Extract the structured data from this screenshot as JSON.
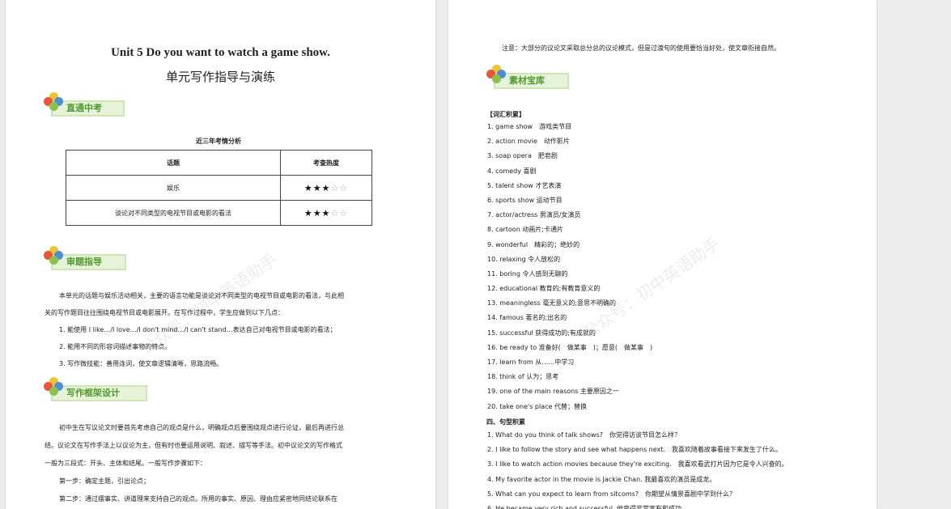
{
  "left_page": {
    "title_en": "Unit 5 Do you want to watch a game show.",
    "title_cn": "单元写作指导与演练",
    "section1_label": "直通中考",
    "table_caption": "近三年考情分析",
    "table_headers": [
      "话题",
      "考查热度"
    ],
    "table_rows": [
      {
        "topic": "娱乐",
        "stars_on": 3,
        "stars_total": 5
      },
      {
        "topic": "谈论对不同类型的电视节目或电影的看法",
        "stars_on": 3,
        "stars_total": 5
      }
    ],
    "section2_label": "审题指导",
    "guide_paragraph_line1": "本单元的话题与娱乐活动相关，主要的语言功能是谈论对不同类型的电视节目或电影的看法，与此相",
    "guide_paragraph_line2": "关的写作题目往往围绕电视节目或电影展开。在写作过程中，学生应做到以下几点：",
    "guide_points": [
      "1. 能使用 I like…/I love…/I don't mind…/I can't stand…表达自己对电视节目或电影的看法；",
      "2. 能用不同的形容词描述事物的特点。",
      "3. 写作微技能：善用连词，使文章逻辑清晰，思路流畅。"
    ],
    "section3_label": "写作框架设计",
    "frame_lines": [
      "初中生在写议论文时要首先考虑自己的观点是什么，明确观点后要围绕观点进行论证，最后再进行总",
      "结。议论文在写作手法上以议论为主，但有时也要运用说明、叙述、描写等手法。初中议论文的写作格式",
      "一般为三段式：开头、主体和结尾。一般写作步骤如下：",
      "第一步：确定主题，引出论点；",
      "第二步：通过摆事实、讲道理来支持自己的观点。所用的事实、原因、理由应紧密地同结论联系在"
    ]
  },
  "right_page": {
    "note": "注意：大部分的议论文采取总分总的议论模式，但是过渡句的使用要恰当好处，使文章衔接自然。",
    "section_label": "素材宝库",
    "vocab_heading": "【词汇积累】",
    "vocab": [
      "1. game show　游戏类节目",
      "2. action movie　动作影片",
      "3. soap opera　肥皂剧",
      "4. comedy  喜剧",
      "5. talent show  才艺表演",
      "6. sports show  运动节目",
      "7. actor/actress  男演员/女演员",
      "8. cartoon  动画片;卡通片",
      "9. wonderful　精彩的；绝妙的",
      "10. relaxing 令人放松的",
      "11. boring  令人感到无聊的",
      "12. educational  教育的;有教育意义的",
      "13. meaningless  毫无意义的;意思不明确的",
      "14. famous  著名的;出名的",
      "15. successful  获得成功的;有成就的",
      "16. be ready to  准备好(　做某事　)；愿意(　做某事　)",
      "17. learn from 从……中学习",
      "18. think of 认为；思考",
      "19. one of the main reasons 主要原因之一",
      "20. take one's place  代替；替换"
    ],
    "sentence_heading": "四、句型积累",
    "sentences": [
      "1. What do you think of talk shows?　你觉得访谈节目怎么样？",
      "2. I like to follow the story and see what happens next.　我喜欢随着故事看接下来发生了什么。",
      "3. I like to watch action movies because they're exciting.　我喜欢看武打片因为它是令人兴奋的。",
      "4. My favorite actor in the movie is Jackie Chan. 我最喜欢的演员是成龙。",
      "5. What can you expect to learn from sitcoms?　你期望从情景喜剧中学到什么？",
      "6. He became very rich and successful. 他变得非常富有和成功。"
    ]
  },
  "watermark_text": "公众号：初中英语助手",
  "colors": {
    "badge_text": "#4f9a2e",
    "badge_bg": "#e7f3d8",
    "badge_border": "#cfe6b4"
  }
}
